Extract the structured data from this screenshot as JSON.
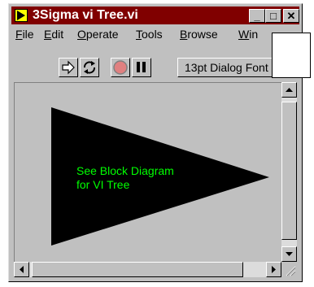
{
  "window": {
    "title": "3Sigma vi Tree.vi",
    "minimize_glyph": "_",
    "maximize_glyph": "□",
    "close_glyph": "✕"
  },
  "menubar": {
    "items": [
      {
        "label": "File",
        "mnemonic": "F",
        "rest": "ile"
      },
      {
        "label": "Edit",
        "mnemonic": "E",
        "rest": "dit"
      },
      {
        "label": "Operate",
        "mnemonic": "O",
        "rest": "perate"
      },
      {
        "label": "Tools",
        "mnemonic": "T",
        "rest": "ools"
      },
      {
        "label": "Browse",
        "mnemonic": "B",
        "rest": "rowse"
      },
      {
        "label": "Win",
        "mnemonic": "W",
        "rest": "in"
      }
    ]
  },
  "toolbar": {
    "font_selector": "13pt Dialog Font",
    "icons": [
      "run-arrow-icon",
      "run-continuously-icon",
      "abort-icon",
      "pause-icon"
    ]
  },
  "panel": {
    "note_line1": "See Block Diagram",
    "note_line2": "for VI Tree"
  },
  "colors": {
    "title_bar": "#800000",
    "panel_bg": "#c0c0c0",
    "triangle": "#000000",
    "note_text": "#00ff00"
  }
}
